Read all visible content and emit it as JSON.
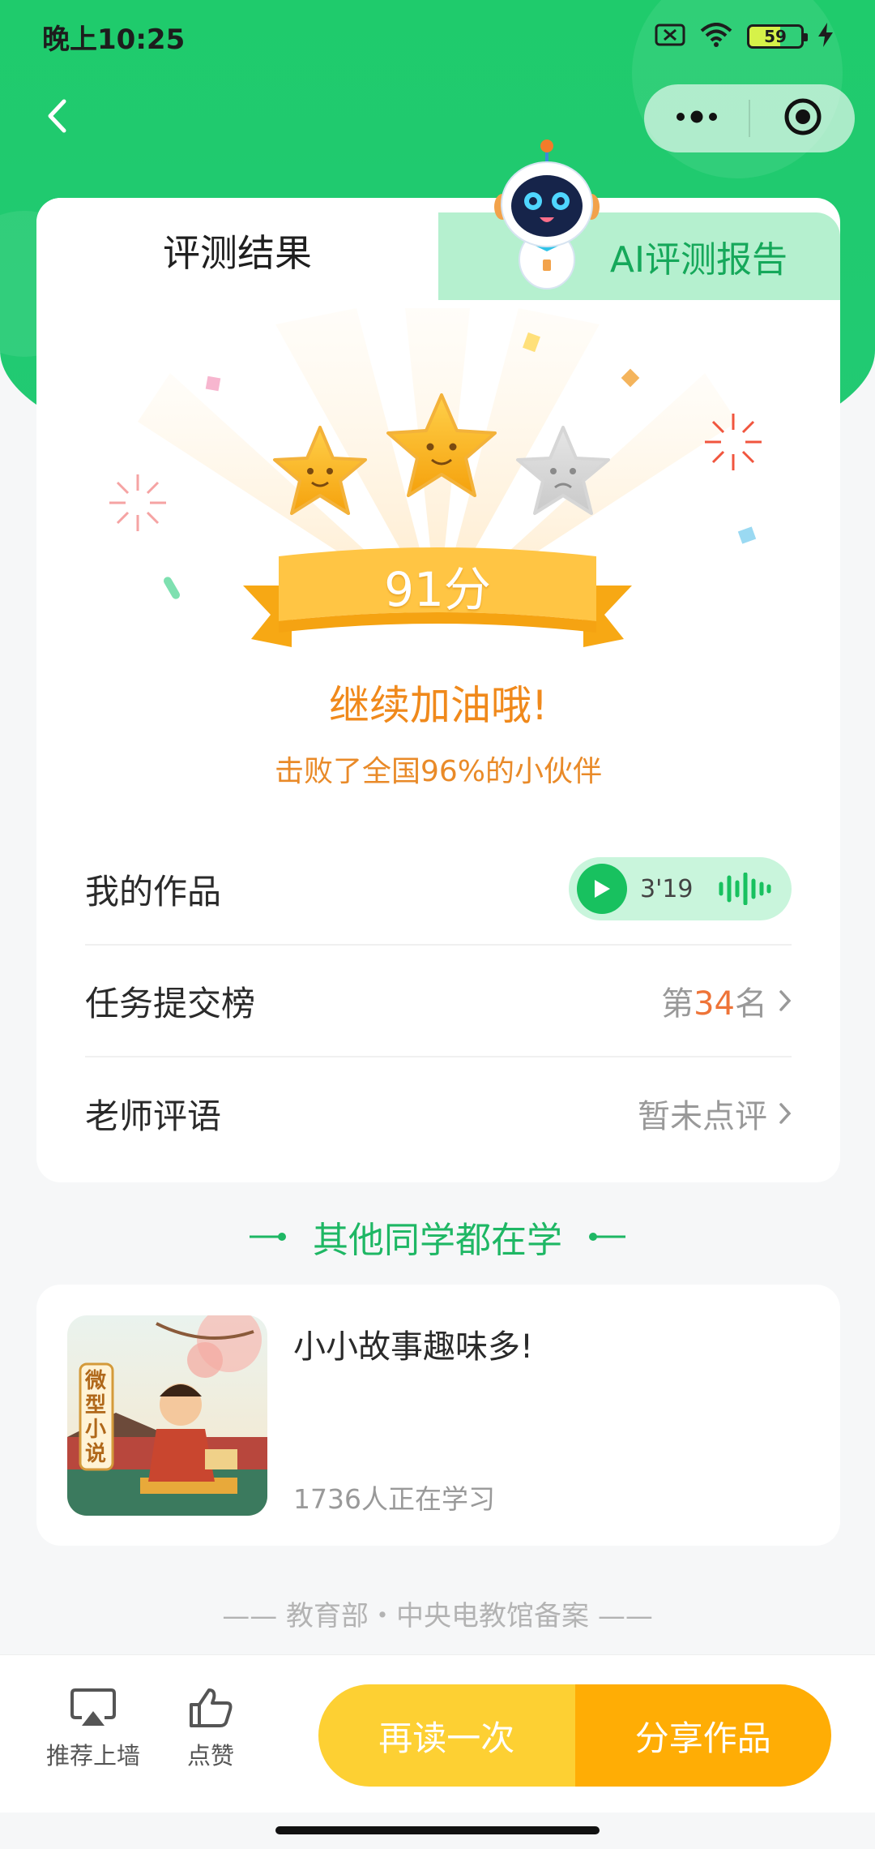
{
  "status_bar": {
    "time": "晚上10:25",
    "battery_level": "59"
  },
  "nav": {
    "back_icon": "chevron-left-icon",
    "menu_icon": "more-dots-icon",
    "close_icon": "target-icon"
  },
  "tabs": [
    {
      "label": "评测结果",
      "active": true
    },
    {
      "label": "AI评测报告",
      "active": false
    }
  ],
  "score": {
    "value_text": "91分",
    "stars_earned": 2,
    "stars_total": 3,
    "cheer": "继续加油哦!",
    "beat_text": "击败了全国96%的小伙伴"
  },
  "rows": {
    "my_work": {
      "label": "我的作品",
      "duration": "3'19"
    },
    "ranking": {
      "label": "任务提交榜",
      "prefix": "第",
      "rank": "34",
      "suffix": "名"
    },
    "teacher_comment": {
      "label": "老师评语",
      "value": "暂未点评"
    }
  },
  "others": {
    "section_title": "其他同学都在学",
    "course": {
      "title": "小小故事趣味多!",
      "learners": "1736人正在学习",
      "thumb_badge": "微型小说"
    }
  },
  "footer_note": "教育部・中央电教馆备案",
  "bottom_bar": {
    "recommend_label": "推荐上墙",
    "like_label": "点赞",
    "reread_label": "再读一次",
    "share_label": "分享作品"
  },
  "colors": {
    "brand_green": "#1fcb6c",
    "tab_inactive_bg": "#b5f0cf",
    "accent_orange": "#f0891b",
    "reread_yellow": "#fdd033",
    "share_orange": "#ffad05"
  }
}
